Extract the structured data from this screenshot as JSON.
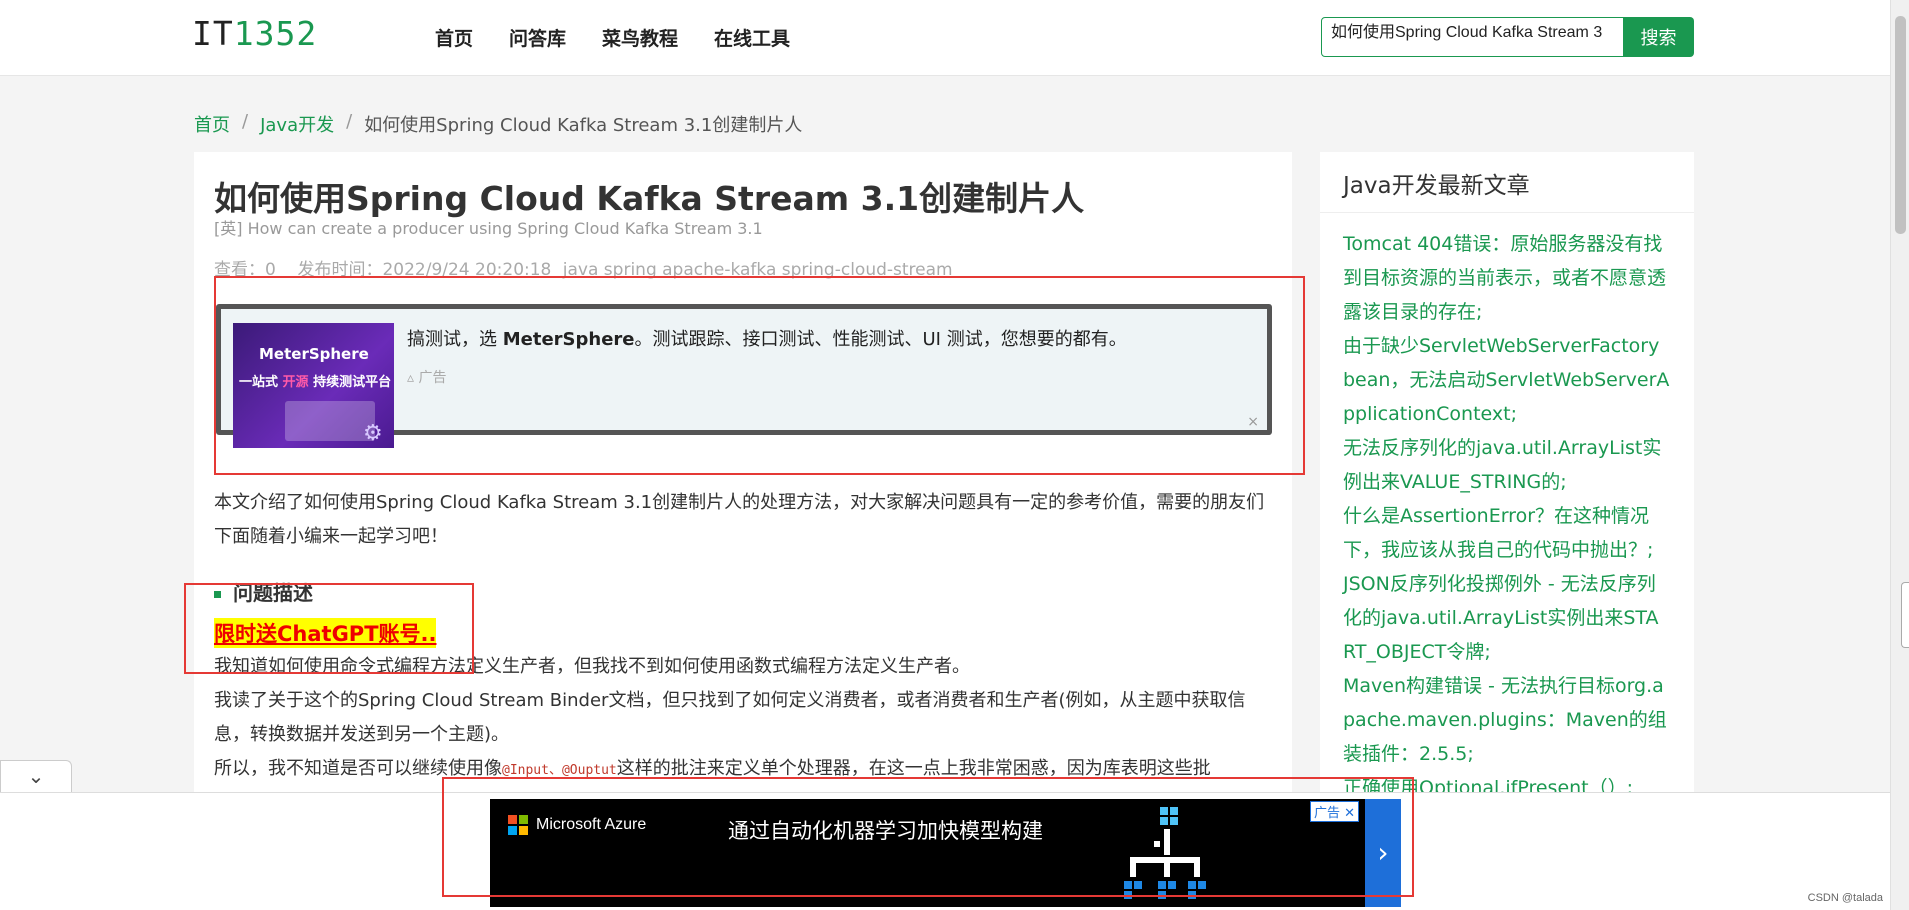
{
  "header": {
    "logo_it": "IT",
    "logo_num": "1352",
    "nav": [
      "首页",
      "问答库",
      "菜鸟教程",
      "在线工具"
    ],
    "search_value": "如何使用Spring Cloud Kafka Stream 3",
    "search_button": "搜索"
  },
  "breadcrumb": {
    "home": "首页",
    "category": "Java开发",
    "current": "如何使用Spring Cloud Kafka Stream 3.1创建制片人",
    "sep": "/"
  },
  "article": {
    "title": "如何使用Spring Cloud Kafka Stream 3.1创建制片人",
    "subtitle": "[英] How can create a producer using Spring Cloud Kafka Stream 3.1",
    "views": "查看：0",
    "published": "发布时间：2022/9/24 20:20:18",
    "tags": "java spring apache-kafka spring-cloud-stream",
    "intro": "本文介绍了如何使用Spring Cloud Kafka Stream 3.1创建制片人的处理方法，对大家解决问题具有一定的参考价值，需要的朋友们下面随着小编来一起学习吧！",
    "section_title": "问题描述",
    "promo": "限时送ChatGPT账号..",
    "p2": "我知道如何使用命令式编程方法定义生产者，但我找不到如何使用函数式编程方法定义生产者。",
    "p3": "我读了关于这个的Spring Cloud Stream Binder文档，但只找到了如何定义消费者，或者消费者和生产者(例如，从主题中获取信息，转换数据并发送到另一个主题)。",
    "p4_before": "所以，我不知道是否可以继续使用像",
    "p4_code": "@Input、@Ouptut",
    "p4_after": "这样的批注来定义单个处理器，在这一点上我非常困惑，因为库表明这些批"
  },
  "ad": {
    "image_logo": "MeterSphere",
    "image_tag_1": "一站式",
    "image_tag_hl": "开源",
    "image_tag_2": "持续测试平台",
    "text_before": "搞测试，选 ",
    "text_brand": "MeterSphere",
    "text_after": "。测试跟踪、接口测试、性能测试、UI 测试，您想要的都有。",
    "label": "广告",
    "close": "×"
  },
  "sidebar": {
    "title": "Java开发最新文章",
    "items": [
      "Tomcat 404错误：原始服务器没有找到目标资源的当前表示，或者不愿意透露该目录的存在;",
      "由于缺少ServletWebServerFactory bean，无法启动ServletWebServerApplicationContext;",
      "无法反序列化的java.util.ArrayList实例出来VALUE_STRING的;",
      "什么是AssertionError？在这种情况下，我应该从我自己的代码中抛出？;",
      "JSON反序列化投掷例外 - 无法反序列化的java.util.ArrayList实例出来START_OBJECT令牌;",
      "Maven构建错误 - 无法执行目标org.apache.maven.plugins：Maven的组装插件：2.5.5;",
      "正确使用Optional.ifPresent（）;"
    ]
  },
  "bottom_ad": {
    "brand": "Microsoft Azure",
    "text": "通过自动化机器学习加快模型构建",
    "badge": "广告",
    "arrow": "›"
  },
  "collapse_icon": "chevron-down-icon",
  "watermark": "CSDN @talada",
  "colors": {
    "accent": "#1a9850",
    "annotation": "#e53935",
    "promo_text": "#ee0000",
    "promo_bg": "#ffff00"
  }
}
